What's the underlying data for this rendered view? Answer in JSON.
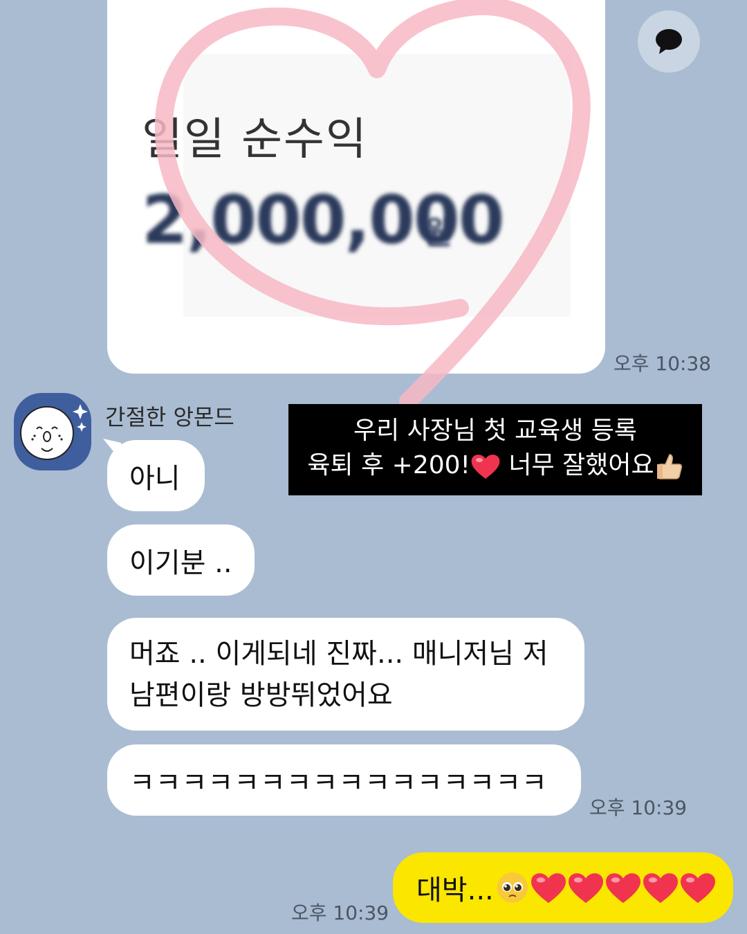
{
  "image_message": {
    "title": "일일 순수익",
    "amount": "2,000,000",
    "unit": "원",
    "timestamp": "오후 10:38"
  },
  "caption": {
    "line1": "우리 사장님 첫 교육생 등록",
    "line2": "육퇴 후 +200!",
    "line2_suffix": " 너무 잘했어요"
  },
  "sender": {
    "name": "간절한 앙몬드"
  },
  "messages": [
    {
      "text": "아니"
    },
    {
      "text": "이기분 .."
    },
    {
      "text": "머죠 .. 이게되네 진짜... 매니저님 저 남편이랑 방방뛰었어요"
    },
    {
      "text": "ㅋㅋㅋㅋㅋㅋㅋㅋㅋㅋㅋㅋㅋㅋㅋㅋ"
    }
  ],
  "received_timestamp": "오후 10:39",
  "my_message": {
    "text": "대박...",
    "timestamp": "오후 10:39"
  },
  "colors": {
    "background": "#a9bcd2",
    "my_bubble": "#fbe600",
    "other_bubble": "#ffffff",
    "heart": "#f7b8c4"
  }
}
